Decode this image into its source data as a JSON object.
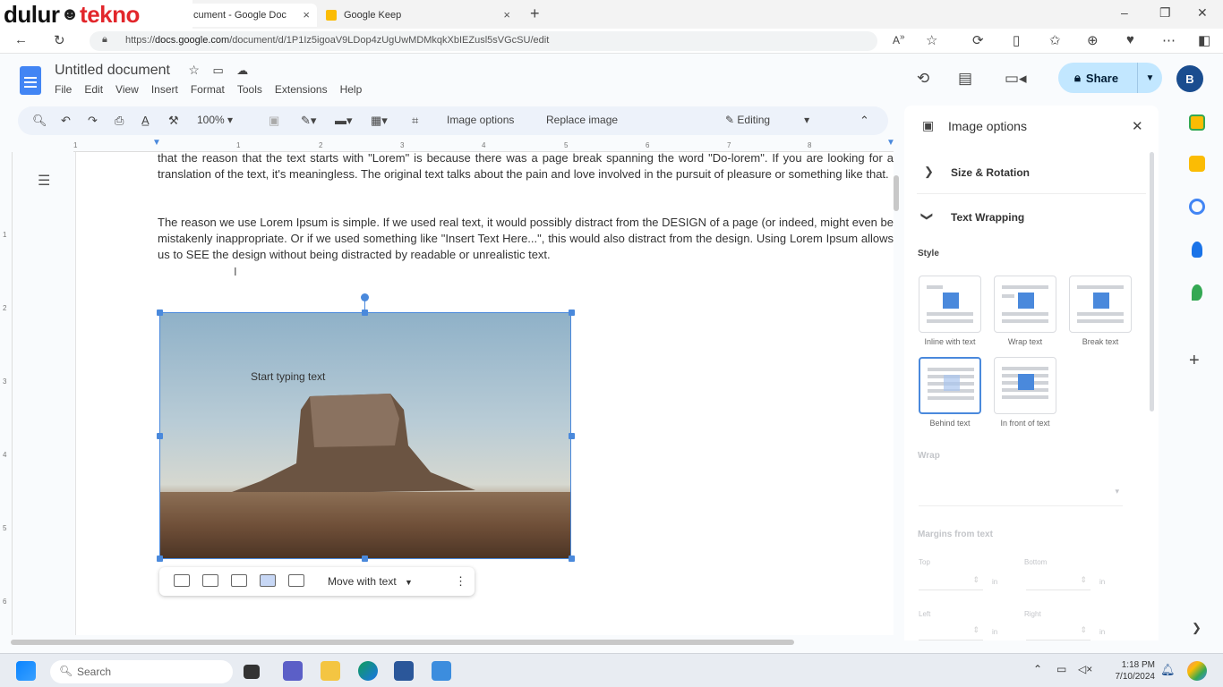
{
  "browser": {
    "tabs": [
      {
        "label": "cument - Google Doc",
        "active": true
      },
      {
        "label": "Google Keep",
        "active": false
      }
    ],
    "url_prefix": "https://",
    "url_domain": "docs.google.com",
    "url_path": "/document/d/1P1Iz5igoaV9LDop4zUgUwMDMkqkXbIEZusl5sVGcSU/edit"
  },
  "watermark": {
    "part1": "dulur",
    "part2": "tekno"
  },
  "doc": {
    "title": "Untitled document",
    "menu": [
      "File",
      "Edit",
      "View",
      "Insert",
      "Format",
      "Tools",
      "Extensions",
      "Help"
    ],
    "share_label": "Share",
    "avatar_letter": "B"
  },
  "toolbar": {
    "zoom": "100%",
    "image_options": "Image options",
    "replace_image": "Replace image",
    "mode": "Editing"
  },
  "ruler": [
    "1",
    "1",
    "2",
    "3",
    "4",
    "5",
    "6",
    "7",
    "8"
  ],
  "vruler": [
    "1",
    "2",
    "3",
    "4",
    "5",
    "6"
  ],
  "body": {
    "para1": "that the reason that the text starts with \"Lorem\" is because there was a page break spanning the word \"Do-lorem\". If you are looking for a translation of the text, it's meaningless. The original text talks about the pain and love involved in the pursuit of pleasure or something like that.",
    "para2": "The reason we use Lorem Ipsum is simple. If we used real text, it would possibly distract from the DESIGN of a page (or indeed, might even be mistakenly inappropriate. Or if we used something like \"Insert Text Here...\", this would also distract from the design. Using Lorem Ipsum allows us to SEE the design without being distracted by readable or unrealistic text.",
    "image_text": "Start typing text"
  },
  "image_toolbar": {
    "position_mode": "Move with text"
  },
  "panel": {
    "title": "Image options",
    "size_rotation": "Size & Rotation",
    "text_wrapping": "Text Wrapping",
    "style_label": "Style",
    "styles": [
      "Inline with text",
      "Wrap text",
      "Break text",
      "Behind text",
      "In front of text"
    ],
    "wrap_label": "Wrap",
    "margins_label": "Margins from text",
    "margin_fields": [
      "Top",
      "Bottom",
      "Left",
      "Right"
    ],
    "unit": "in"
  },
  "taskbar": {
    "search_placeholder": "Search",
    "time": "1:18 PM",
    "date": "7/10/2024"
  },
  "colors": {
    "accent": "#4a89dc",
    "share_bg": "#c2e7ff",
    "brand_red": "#e2262b"
  }
}
